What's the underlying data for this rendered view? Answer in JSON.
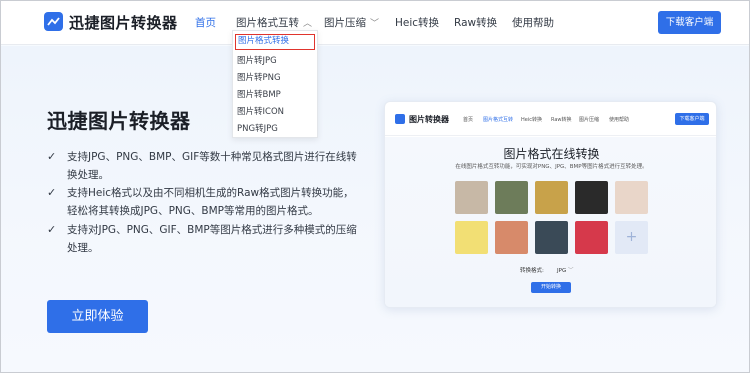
{
  "header": {
    "brand": "迅捷图片转换器",
    "nav": [
      {
        "label": "首页",
        "active": true
      },
      {
        "label": "图片格式互转",
        "active": false,
        "has_caret": true
      },
      {
        "label": "图片压缩",
        "active": false,
        "has_caret": true
      },
      {
        "label": "Heic转换",
        "active": false
      },
      {
        "label": "Raw转换",
        "active": false
      },
      {
        "label": "使用帮助",
        "active": false
      }
    ],
    "download_button": "下载客户端",
    "caret_icon": "chevron-up-icon"
  },
  "dropdown": {
    "items": [
      "图片格式转换",
      "图片转JPG",
      "图片转PNG",
      "图片转BMP",
      "图片转ICON",
      "PNG转JPG"
    ],
    "selected_index": 0
  },
  "hero": {
    "title": "迅捷图片转换器",
    "features": [
      "支持JPG、PNG、BMP、GIF等数十种常见格式图片进行在线转换处理。",
      "支持Heic格式以及由不同相机生成的Raw格式图片转换功能，轻松将其转换成JPG、PNG、BMP等常用的图片格式。",
      "支持对JPG、PNG、GIF、BMP等图片格式进行多种模式的压缩处理。"
    ],
    "check_icon": "check-icon",
    "cta": "立即体验"
  },
  "preview": {
    "brand": "图片转换器",
    "nav": [
      "首页",
      "图片格式互转",
      "Heic转换",
      "Raw转换",
      "图片压缩",
      "使用帮助"
    ],
    "active_nav_index": 1,
    "download_button": "下载客户端",
    "title": "图片格式在线转换",
    "subtitle": "在线图片格式互转功能，可实现对PNG、JPG、BMP等图片格式进行互转处理。",
    "format_label": "转换格式:",
    "format_value": "JPG",
    "start_button": "开始转换",
    "add_icon": "plus-icon",
    "thumbnail_colors": [
      "#c7b8a6",
      "#6d7c5a",
      "#c8a24a",
      "#2a2a2a",
      "#e9d6c9",
      "#f2df74",
      "#d78a6a",
      "#3a4a57",
      "#d6394b"
    ]
  },
  "colors": {
    "accent": "#2f6fe8",
    "highlight_border": "#e0342d"
  }
}
